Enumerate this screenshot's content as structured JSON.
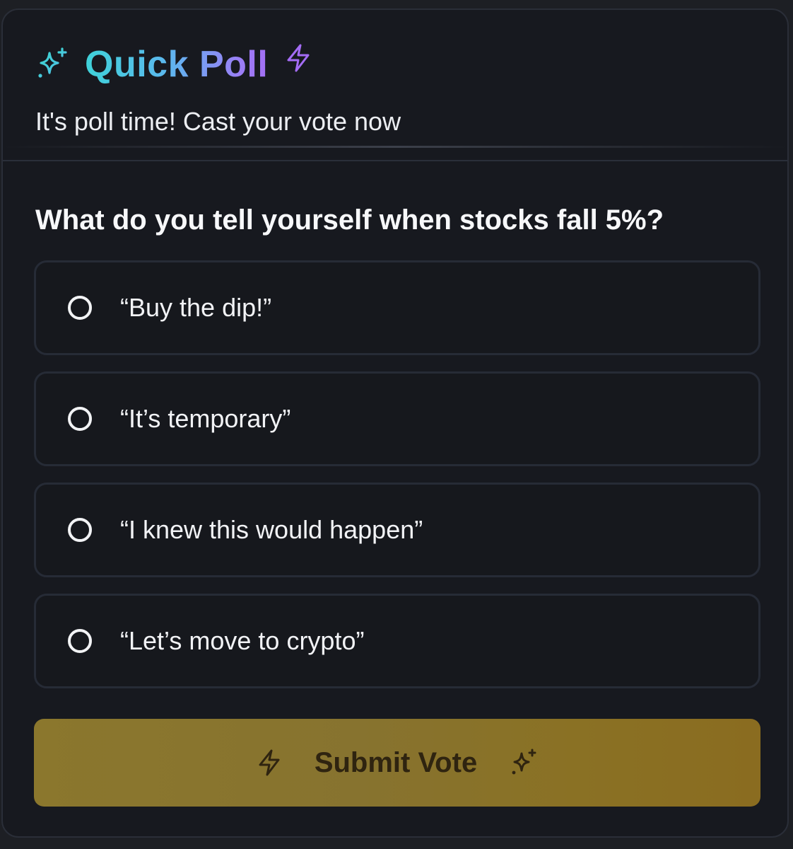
{
  "header": {
    "title": "Quick Poll",
    "subtitle": "It's poll time! Cast your vote now",
    "icons": [
      "sparkles-icon",
      "zap-icon"
    ]
  },
  "poll": {
    "question": "What do you tell yourself when stocks fall 5%?",
    "options": [
      {
        "label": "“Buy the dip!”",
        "selected": false
      },
      {
        "label": "“It’s temporary”",
        "selected": false
      },
      {
        "label": "“I knew this would happen”",
        "selected": false
      },
      {
        "label": "“Let’s move to crypto”",
        "selected": false
      }
    ]
  },
  "submit": {
    "label": "Submit Vote",
    "icons": [
      "zap-icon",
      "sparkles-icon"
    ]
  },
  "colors": {
    "background": "#17191f",
    "title_gradient_start": "#3fd2d9",
    "title_gradient_end": "#a36ff4",
    "submit_bg": "#8b772d",
    "submit_text": "#2f2410"
  }
}
